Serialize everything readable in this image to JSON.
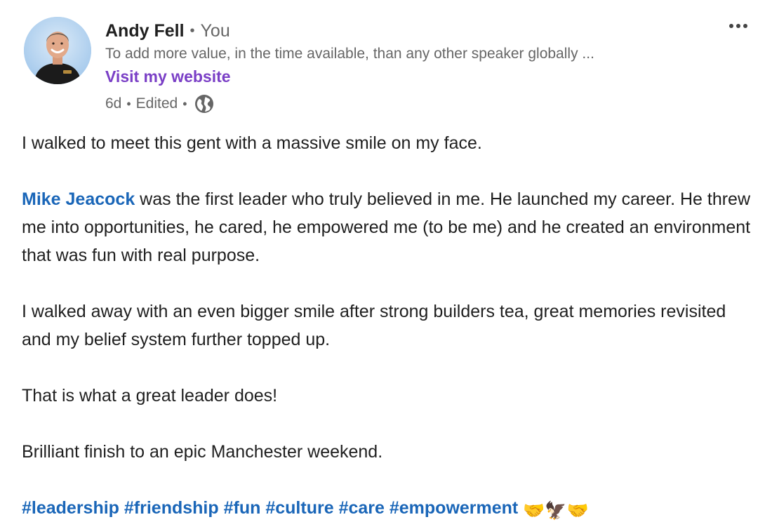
{
  "author": {
    "name": "Andy Fell",
    "relation": "You",
    "separator": "•",
    "headline": "To add more value, in the time available, than any other speaker globally ...",
    "website_label": "Visit my website",
    "time_ago": "6d",
    "edited_label": "Edited",
    "visibility_icon": "globe-icon"
  },
  "menu": {
    "more_icon": "ellipsis-icon"
  },
  "post": {
    "p1": "I walked to meet this gent with a massive smile on my face.",
    "p2_mention": "Mike Jeacock",
    "p2_text": " was the first leader who truly believed in me. He launched my career. He threw me into opportunities, he cared, he empowered me (to be me) and he created an environment that was fun with real purpose.",
    "p3": "I walked away with an even bigger smile after strong builders tea, great memories revisited and my belief system further topped up.",
    "p4": "That is what a great leader does!",
    "p5": "Brilliant finish to an epic Manchester weekend.",
    "hashtags": [
      "#leadership",
      "#friendship",
      "#fun",
      "#culture",
      "#care",
      "#empowerment"
    ],
    "emojis": [
      "🤝",
      "🦅",
      "🤝"
    ]
  },
  "colors": {
    "link_blue": "#1a66b8",
    "website_purple": "#7a3fc6",
    "muted_gray": "#666666",
    "text": "#1f1f1f"
  }
}
